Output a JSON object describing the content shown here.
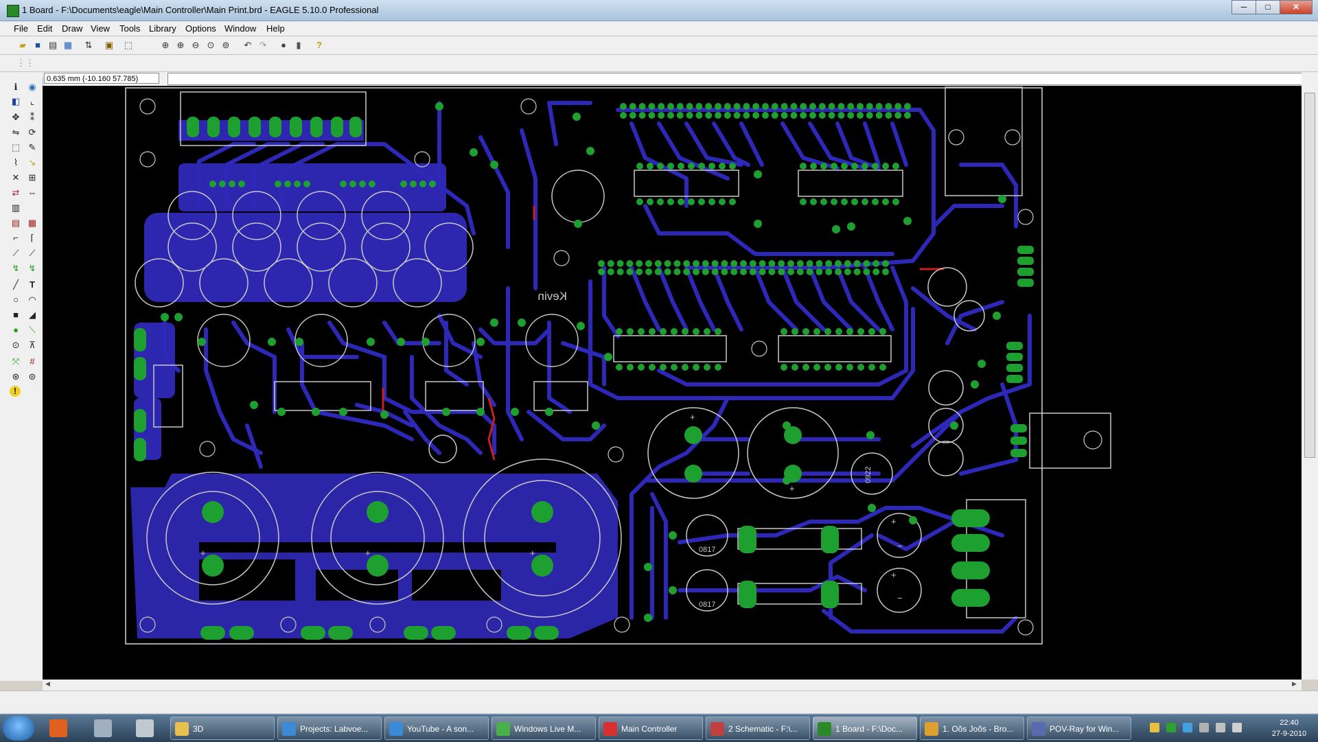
{
  "window": {
    "title": "1 Board - F:\\Documents\\eagle\\Main Controller\\Main Print.brd - EAGLE 5.10.0 Professional"
  },
  "window_buttons": {
    "minimize": "─",
    "maximize": "□",
    "close": "✕"
  },
  "menu": [
    {
      "id": "file",
      "label": "File"
    },
    {
      "id": "edit",
      "label": "Edit"
    },
    {
      "id": "draw",
      "label": "Draw"
    },
    {
      "id": "view",
      "label": "View"
    },
    {
      "id": "tools",
      "label": "Tools"
    },
    {
      "id": "library",
      "label": "Library"
    },
    {
      "id": "options",
      "label": "Options"
    },
    {
      "id": "window",
      "label": "Window"
    },
    {
      "id": "help",
      "label": "Help"
    }
  ],
  "toolbar": {
    "help_icon": "?"
  },
  "coords": {
    "readout": "0.635 mm (-10.160 57.785)"
  },
  "board": {
    "silk_text": "Kevin",
    "part_label": "0817",
    "part_label_alt": "0922",
    "plus": "+",
    "minus": "−"
  },
  "taskbar": {
    "items": [
      {
        "label": "3D",
        "color": "#e8c050"
      },
      {
        "label": "Projects: Labvoe...",
        "color": "#3a8ad8"
      },
      {
        "label": "YouTube - A son...",
        "color": "#3a8ad8"
      },
      {
        "label": "Windows Live M...",
        "color": "#4ab04a"
      },
      {
        "label": "Main Controller",
        "color": "#d83030"
      },
      {
        "label": "2 Schematic - F:\\...",
        "color": "#c04040"
      },
      {
        "label": "1 Board - F:\\Doc...",
        "color": "#2a8a2a"
      },
      {
        "label": "1. Oõs Joõs - Bro...",
        "color": "#e0a030"
      },
      {
        "label": "POV-Ray for Win...",
        "color": "#5a6ab0"
      }
    ],
    "clock_time": "22:40",
    "clock_date": "27-9-2010"
  }
}
